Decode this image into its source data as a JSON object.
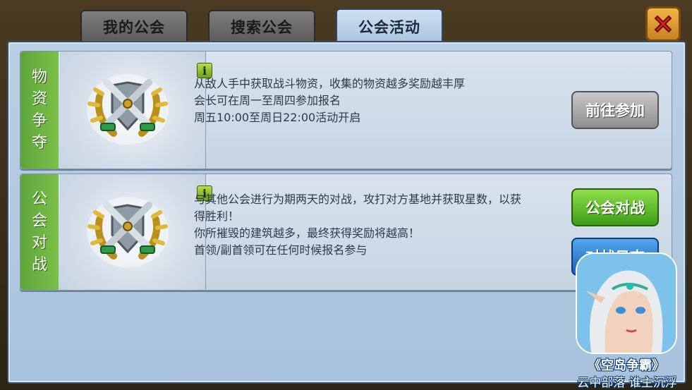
{
  "tabs": [
    {
      "label": "我的公会",
      "active": false
    },
    {
      "label": "搜索公会",
      "active": false
    },
    {
      "label": "公会活动",
      "active": true
    }
  ],
  "activities": [
    {
      "category_chars": [
        "物",
        "资",
        "争",
        "夺"
      ],
      "info_glyph": "i",
      "description_lines": [
        "从敌人手中获取战斗物资，收集的物资越多奖励越丰厚",
        "会长可在周一至周四参加报名",
        "周五10:00至周日22:00活动开启"
      ],
      "buttons": [
        {
          "label": "前往参加",
          "style": "gray"
        }
      ]
    },
    {
      "category_chars": [
        "公",
        "会",
        "对",
        "战"
      ],
      "info_glyph": "i",
      "description_lines": [
        "与其他公会进行为期两天的对战，攻打对方基地并获取星数，以获",
        "得胜利！",
        "你所摧毁的建筑越多，最终获得奖励将越高！",
        "首领/副首领可在任何时候报名参与"
      ],
      "buttons": [
        {
          "label": "公会对战",
          "style": "green"
        },
        {
          "label": "对战日志",
          "style": "blue"
        }
      ]
    }
  ],
  "ad": {
    "title": "《空岛争霸》",
    "subtitle": "云中部落 谁主沉浮"
  },
  "colors": {
    "accent_green": "#5ea53a",
    "panel_bg": "#c6d4e2",
    "close_red": "#d8261b"
  },
  "icons": {
    "close": "close-x-icon",
    "info": "info-icon",
    "emblem": "crossed-swords-laurel-icon"
  }
}
